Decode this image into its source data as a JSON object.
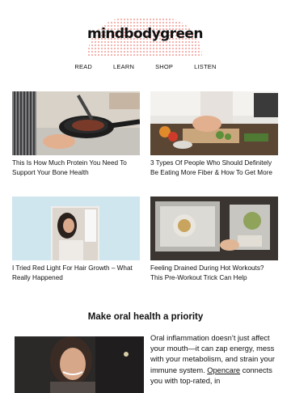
{
  "brand": {
    "logo_text": "mindbodygreen"
  },
  "nav": {
    "items": [
      "READ",
      "LEARN",
      "SHOP",
      "LISTEN"
    ]
  },
  "articles": [
    {
      "title": "This Is How Much Protein You Need To Support Your Bone Health",
      "image": "cooking-steak-pan-photo"
    },
    {
      "title": "3 Types Of People Who Should Definitely Be Eating More Fiber & How To Get More",
      "image": "chopping-vegetables-kitchen-photo"
    },
    {
      "title": "I Tried Red Light For Hair Growth – What Really Happened",
      "image": "woman-red-light-device-photo"
    },
    {
      "title": "Feeling Drained During Hot Workouts? This Pre-Workout Trick Can Help",
      "image": "drink-tray-workout-photo"
    }
  ],
  "promo": {
    "heading": "Make oral health a priority",
    "text_before_link": "Oral inflammation doesn’t just affect your mouth—it can zap energy, mess with your metabolism, and strain your immune system. ",
    "link_text": "Opencare",
    "text_after_link": " connects you with top-rated, in",
    "image": "smiling-woman-gym-photo"
  },
  "colors": {
    "logo_dots": "#f2a9a2",
    "text": "#111111",
    "background": "#ffffff"
  }
}
